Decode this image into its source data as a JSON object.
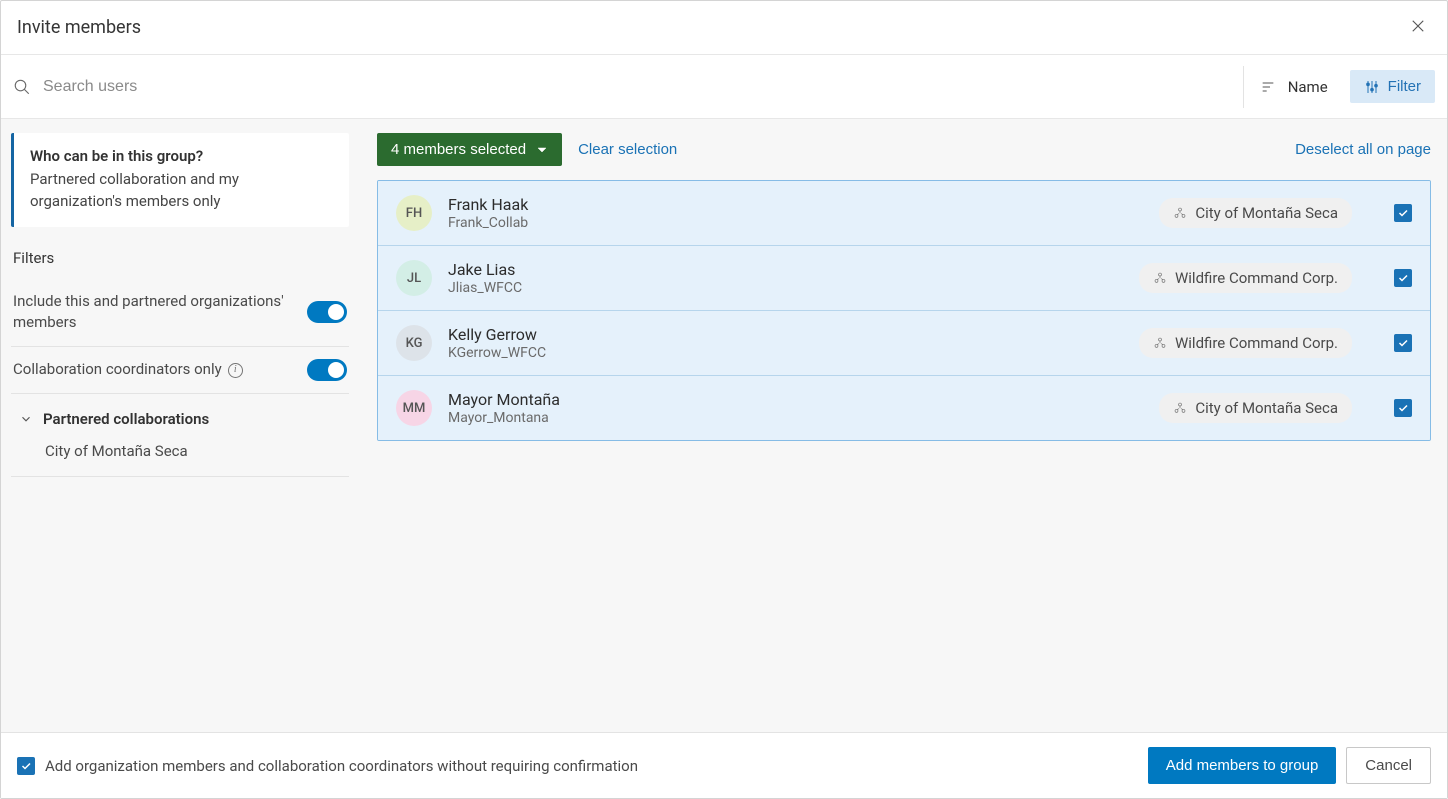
{
  "header": {
    "title": "Invite members"
  },
  "search": {
    "placeholder": "Search users"
  },
  "sort": {
    "label": "Name"
  },
  "filterBtn": {
    "label": "Filter"
  },
  "sidebar": {
    "info": {
      "question": "Who can be in this group?",
      "answer": "Partnered collaboration and my organization's members only"
    },
    "filtersHeading": "Filters",
    "toggle1": {
      "label": "Include this and partnered organizations' members",
      "on": true
    },
    "toggle2": {
      "label": "Collaboration coordinators only",
      "on": true
    },
    "collabHeader": "Partnered collaborations",
    "collabItems": [
      "City of Montaña Seca"
    ]
  },
  "selection": {
    "pill": "4 members selected",
    "clear": "Clear selection",
    "deselect": "Deselect all on page"
  },
  "users": [
    {
      "initials": "FH",
      "name": "Frank Haak",
      "login": "Frank_Collab",
      "org": "City of Montaña Seca",
      "avatarBg": "#e6efc7",
      "checked": true
    },
    {
      "initials": "JL",
      "name": "Jake Lias",
      "login": "Jlias_WFCC",
      "org": "Wildfire Command Corp.",
      "avatarBg": "#d3eee6",
      "checked": true
    },
    {
      "initials": "KG",
      "name": "Kelly Gerrow",
      "login": "KGerrow_WFCC",
      "org": "Wildfire Command Corp.",
      "avatarBg": "#dde3e9",
      "checked": true
    },
    {
      "initials": "MM",
      "name": "Mayor Montaña",
      "login": "Mayor_Montana",
      "org": "City of Montaña Seca",
      "avatarBg": "#f7d5e6",
      "checked": true
    }
  ],
  "footer": {
    "confirmLabel": "Add organization members and collaboration coordinators without requiring confirmation",
    "primary": "Add members to group",
    "secondary": "Cancel"
  }
}
